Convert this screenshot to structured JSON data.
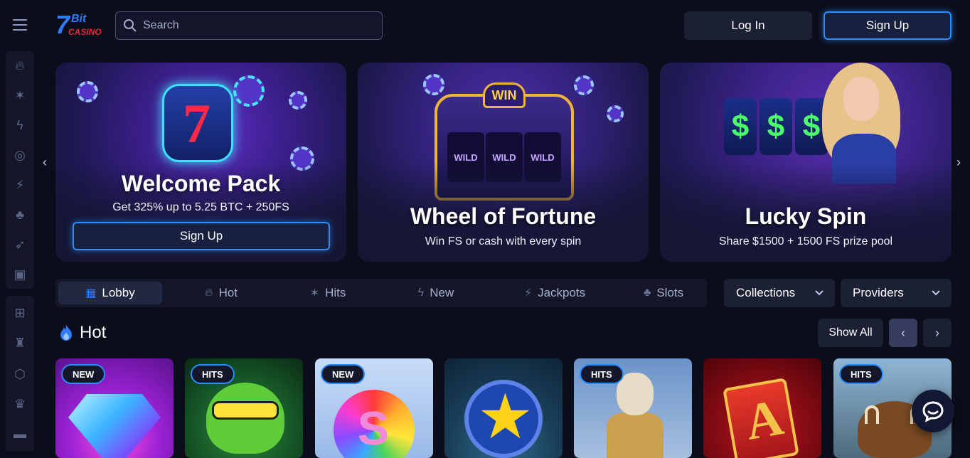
{
  "header": {
    "search_placeholder": "Search",
    "login_label": "Log In",
    "signup_label": "Sign Up",
    "brand_color": "#2a8dff"
  },
  "sidebar": {
    "icons": [
      "fire-icon",
      "star-burst-icon",
      "lightning-icon",
      "target-icon",
      "jackpot-icon",
      "cherries-icon",
      "rocket-icon",
      "cards-icon",
      "gift-icon",
      "trophy-icon",
      "lottery-icon",
      "crown-icon",
      "ticket-icon"
    ]
  },
  "banners": [
    {
      "title": "Welcome Pack",
      "subtitle": "Get 325% up to 5.25 BTC + 250FS",
      "cta": "Sign Up"
    },
    {
      "title": "Wheel of Fortune",
      "subtitle": "Win FS or cash with every spin",
      "art_text": "WIN",
      "reel_text": "WILD"
    },
    {
      "title": "Lucky Spin",
      "subtitle": "Share $1500 + 1500 FS prize pool",
      "reel_symbol": "$"
    }
  ],
  "tabs": [
    {
      "label": "Lobby",
      "icon": "lobby-icon",
      "active": true
    },
    {
      "label": "Hot",
      "icon": "fire-icon",
      "active": false
    },
    {
      "label": "Hits",
      "icon": "star-burst-icon",
      "active": false
    },
    {
      "label": "New",
      "icon": "lightning-icon",
      "active": false
    },
    {
      "label": "Jackpots",
      "icon": "jackpot-icon",
      "active": false
    },
    {
      "label": "Slots",
      "icon": "cherries-icon",
      "active": false
    }
  ],
  "filters": {
    "collections_label": "Collections",
    "providers_label": "Providers"
  },
  "section": {
    "title": "Hot",
    "show_all_label": "Show All"
  },
  "games": [
    {
      "badge": "NEW"
    },
    {
      "badge": "HITS"
    },
    {
      "badge": "NEW"
    },
    {
      "badge": ""
    },
    {
      "badge": "HITS"
    },
    {
      "badge": ""
    },
    {
      "badge": "HITS"
    }
  ]
}
